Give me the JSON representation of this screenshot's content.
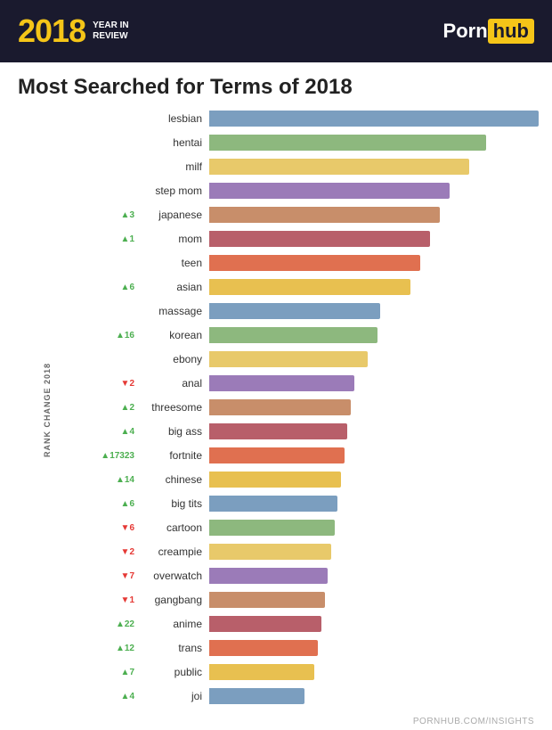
{
  "header": {
    "year": "2018",
    "year_sub1": "YEAR IN",
    "year_sub2": "REVIEW",
    "logo_porn": "Porn",
    "logo_hub": "hub"
  },
  "title": "Most Searched for Terms of 2018",
  "footer_url": "PORNHUB.COM/INSIGHTS",
  "rank_change_label": "RANK CHANGE 2018",
  "bars": [
    {
      "term": "lesbian",
      "rank": "",
      "dir": "",
      "pct": 100,
      "color": "#7b9ebf"
    },
    {
      "term": "hentai",
      "rank": "",
      "dir": "",
      "pct": 84,
      "color": "#8db87e"
    },
    {
      "term": "milf",
      "rank": "",
      "dir": "",
      "pct": 79,
      "color": "#e8c96a"
    },
    {
      "term": "step mom",
      "rank": "",
      "dir": "",
      "pct": 73,
      "color": "#9b7bb8"
    },
    {
      "term": "japanese",
      "rank": "3",
      "dir": "up",
      "pct": 70,
      "color": "#c88e6a"
    },
    {
      "term": "mom",
      "rank": "1",
      "dir": "up",
      "pct": 67,
      "color": "#b85f6a"
    },
    {
      "term": "teen",
      "rank": "",
      "dir": "",
      "pct": 64,
      "color": "#e07050"
    },
    {
      "term": "asian",
      "rank": "6",
      "dir": "up",
      "pct": 61,
      "color": "#e8c050"
    },
    {
      "term": "massage",
      "rank": "",
      "dir": "",
      "pct": 52,
      "color": "#7b9ebf"
    },
    {
      "term": "korean",
      "rank": "16",
      "dir": "up",
      "pct": 51,
      "color": "#8db87e"
    },
    {
      "term": "ebony",
      "rank": "",
      "dir": "",
      "pct": 48,
      "color": "#e8c96a"
    },
    {
      "term": "anal",
      "rank": "2",
      "dir": "down",
      "pct": 44,
      "color": "#9b7bb8"
    },
    {
      "term": "threesome",
      "rank": "2",
      "dir": "up",
      "pct": 43,
      "color": "#c88e6a"
    },
    {
      "term": "big ass",
      "rank": "4",
      "dir": "up",
      "pct": 42,
      "color": "#b85f6a"
    },
    {
      "term": "fortnite",
      "rank": "17323",
      "dir": "up",
      "pct": 41,
      "color": "#e07050"
    },
    {
      "term": "chinese",
      "rank": "14",
      "dir": "up",
      "pct": 40,
      "color": "#e8c050"
    },
    {
      "term": "big tits",
      "rank": "6",
      "dir": "up",
      "pct": 39,
      "color": "#7b9ebf"
    },
    {
      "term": "cartoon",
      "rank": "6",
      "dir": "down",
      "pct": 38,
      "color": "#8db87e"
    },
    {
      "term": "creampie",
      "rank": "2",
      "dir": "down",
      "pct": 37,
      "color": "#e8c96a"
    },
    {
      "term": "overwatch",
      "rank": "7",
      "dir": "down",
      "pct": 36,
      "color": "#9b7bb8"
    },
    {
      "term": "gangbang",
      "rank": "1",
      "dir": "down",
      "pct": 35,
      "color": "#c88e6a"
    },
    {
      "term": "anime",
      "rank": "22",
      "dir": "up",
      "pct": 34,
      "color": "#b85f6a"
    },
    {
      "term": "trans",
      "rank": "12",
      "dir": "up",
      "pct": 33,
      "color": "#e07050"
    },
    {
      "term": "public",
      "rank": "7",
      "dir": "up",
      "pct": 32,
      "color": "#e8c050"
    },
    {
      "term": "joi",
      "rank": "4",
      "dir": "up",
      "pct": 29,
      "color": "#7b9ebf"
    }
  ]
}
